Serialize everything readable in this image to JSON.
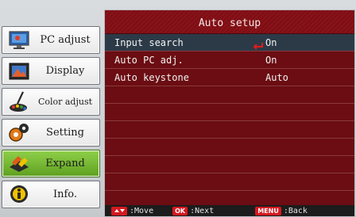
{
  "sidebar": {
    "items": [
      {
        "label": "PC adjust",
        "icon": "monitor-icon",
        "active": false
      },
      {
        "label": "Display",
        "icon": "display-icon",
        "active": false
      },
      {
        "label": "Color adjust",
        "icon": "paint-brush-icon",
        "active": false
      },
      {
        "label": "Setting",
        "icon": "gears-icon",
        "active": false
      },
      {
        "label": "Expand",
        "icon": "expand-icon",
        "active": true
      },
      {
        "label": "Info.",
        "icon": "info-icon",
        "active": false
      }
    ]
  },
  "panel": {
    "title": "Auto setup",
    "rows": [
      {
        "name": "Input search",
        "value": "On",
        "selected": true
      },
      {
        "name": "Auto PC adj.",
        "value": "On",
        "selected": false
      },
      {
        "name": "Auto keystone",
        "value": "Auto",
        "selected": false
      }
    ]
  },
  "footer": {
    "move_label": ":Move",
    "ok_key": "OK",
    "next_label": ":Next",
    "menu_key": "MENU",
    "back_label": ":Back"
  },
  "colors": {
    "panel_bg": "#6b0d12",
    "selected_row": "#2c3a47",
    "active_tab": "#6fb52c",
    "key_red": "#d6181f"
  }
}
